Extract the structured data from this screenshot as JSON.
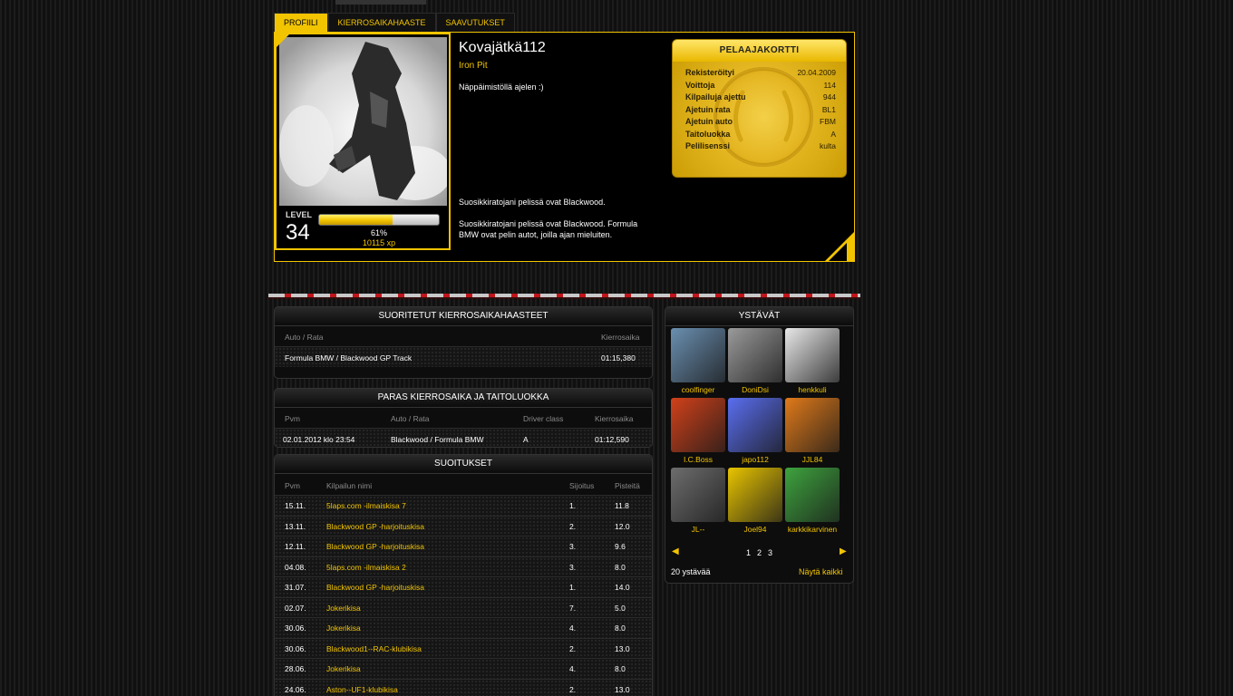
{
  "tabs": [
    {
      "label": "PROFIILI",
      "active": true
    },
    {
      "label": "KIERROSAIKAHAASTE",
      "active": false
    },
    {
      "label": "SAAVUTUKSET",
      "active": false
    }
  ],
  "profile": {
    "name": "Kovajätkä112",
    "team": "Iron Pit",
    "bio": "Näppäimistöllä ajelen :)",
    "favorite_track_text": "Suosikkiratojani pelissä ovat Blackwood.",
    "favorite_full_text": "Suosikkiratojani pelissä ovat Blackwood. Formula BMW ovat pelin autot, joilla ajan mieluiten.",
    "level_label": "LEVEL",
    "level": "34",
    "xp_fraction": 0.61,
    "xp_percent_text": "61%",
    "xp_total_text": "10115 xp"
  },
  "player_card": {
    "title": "PELAAJAKORTTI",
    "rows": [
      {
        "label": "Rekisteröityi",
        "value": "20.04.2009"
      },
      {
        "label": "Voittoja",
        "value": "114"
      },
      {
        "label": "Kilpailuja ajettu",
        "value": "944"
      },
      {
        "label": "Ajetuin rata",
        "value": "BL1"
      },
      {
        "label": "Ajetuin auto",
        "value": "FBM"
      },
      {
        "label": "Taitoluokka",
        "value": "A"
      },
      {
        "label": "Pelilisenssi",
        "value": "kulta"
      }
    ]
  },
  "completed_challenges": {
    "title": "SUORITETUT KIERROSAIKAHAASTEET",
    "headers": {
      "car_track": "Auto / Rata",
      "laptime": "Kierrosaika"
    },
    "rows": [
      {
        "car_track": "Formula BMW / Blackwood GP Track",
        "laptime": "01:15,380"
      }
    ]
  },
  "best_lap": {
    "title": "PARAS KIERROSAIKA JA TAITOLUOKKA",
    "headers": {
      "date": "Pvm",
      "car_track": "Auto / Rata",
      "class": "Driver class",
      "laptime": "Kierrosaika"
    },
    "row": {
      "date": "02.01.2012 klo 23:54",
      "car_track": "Blackwood / Formula BMW",
      "class": "A",
      "laptime": "01:12,590"
    }
  },
  "races": {
    "title": "SUOITUKSET",
    "headers": {
      "date": "Pvm",
      "name": "Kilpailun nimi",
      "position": "Sijoitus",
      "points": "Pisteitä"
    },
    "rows": [
      {
        "date": "15.11.",
        "name": "5laps.com -ilmaiskisa 7",
        "position": "1.",
        "points": "11.8"
      },
      {
        "date": "13.11.",
        "name": "Blackwood GP -harjoituskisa",
        "position": "2.",
        "points": "12.0"
      },
      {
        "date": "12.11.",
        "name": "Blackwood GP -harjoituskisa",
        "position": "3.",
        "points": "9.6"
      },
      {
        "date": "04.08.",
        "name": "5laps.com -ilmaiskisa 2",
        "position": "3.",
        "points": "8.0"
      },
      {
        "date": "31.07.",
        "name": "Blackwood GP -harjoituskisa",
        "position": "1.",
        "points": "14.0"
      },
      {
        "date": "02.07.",
        "name": "Jokerikisa",
        "position": "7.",
        "points": "5.0"
      },
      {
        "date": "30.06.",
        "name": "Jokerikisa",
        "position": "4.",
        "points": "8.0"
      },
      {
        "date": "30.06.",
        "name": "Blackwood1--RAC-klubikisa",
        "position": "2.",
        "points": "13.0"
      },
      {
        "date": "28.06.",
        "name": "Jokerikisa",
        "position": "4.",
        "points": "8.0"
      },
      {
        "date": "24.06.",
        "name": "Aston--UF1-klubikisa",
        "position": "2.",
        "points": "13.0"
      }
    ]
  },
  "friends": {
    "title": "YSTÄVÄT",
    "items": [
      {
        "name": "coolfinger",
        "color": "#6a8fb0"
      },
      {
        "name": "DoniDsi",
        "color": "#9a9a9a"
      },
      {
        "name": "henkkuli",
        "color": "#e8e8e8"
      },
      {
        "name": "I.C.Boss",
        "color": "#d1411a"
      },
      {
        "name": "japo112",
        "color": "#5a6ef0"
      },
      {
        "name": "JJL84",
        "color": "#e07a1a"
      },
      {
        "name": "JL--",
        "color": "#6d6d6d"
      },
      {
        "name": "Joel94",
        "color": "#e8c400"
      },
      {
        "name": "karkkikarvinen",
        "color": "#3ea33e"
      }
    ],
    "pages": [
      "1",
      "2",
      "3"
    ],
    "count_text": "20 ystävää",
    "show_all": "Näytä kaikki"
  },
  "colors": {
    "accent": "#f2c400",
    "card_gold": "#e5b823",
    "stripe_red": "#c0141a"
  }
}
